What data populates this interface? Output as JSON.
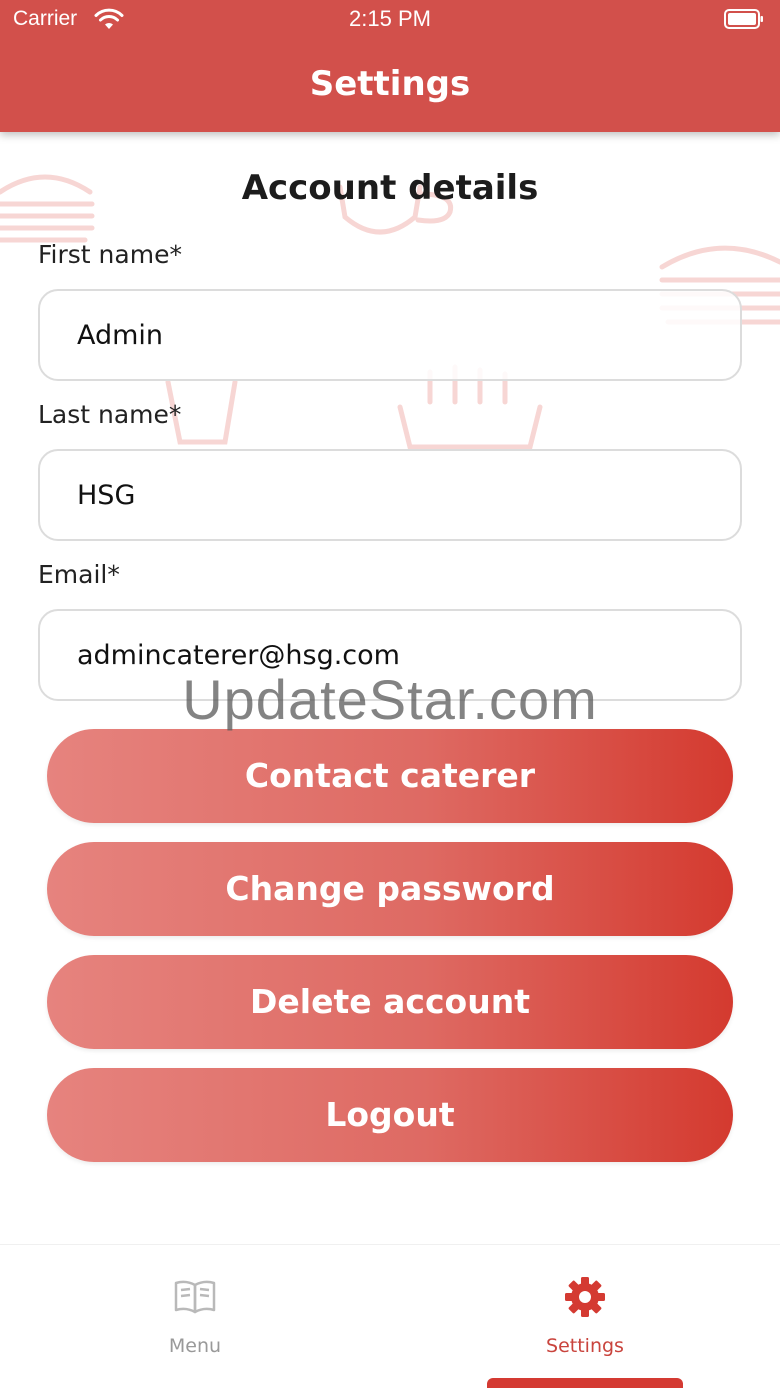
{
  "status_bar": {
    "carrier": "Carrier",
    "time": "2:15 PM"
  },
  "header": {
    "title": "Settings"
  },
  "account": {
    "title": "Account details",
    "first_name_label": "First name*",
    "first_name_value": "Admin",
    "last_name_label": "Last name*",
    "last_name_value": "HSG",
    "email_label": "Email*",
    "email_value": "admincaterer@hsg.com"
  },
  "watermark": "UpdateStar.com",
  "buttons": {
    "contact_caterer": "Contact caterer",
    "change_password": "Change password",
    "delete_account": "Delete account",
    "logout": "Logout"
  },
  "tabbar": {
    "items": [
      {
        "label": "Menu",
        "icon": "book-icon",
        "active": false
      },
      {
        "label": "Settings",
        "icon": "gear-icon",
        "active": true
      }
    ]
  },
  "colors": {
    "accent": "#d2504b",
    "button_gradient_start": "#e6837e",
    "button_gradient_end": "#d43a2f",
    "active_tab": "#c9443d",
    "inactive_tab": "#999999"
  }
}
